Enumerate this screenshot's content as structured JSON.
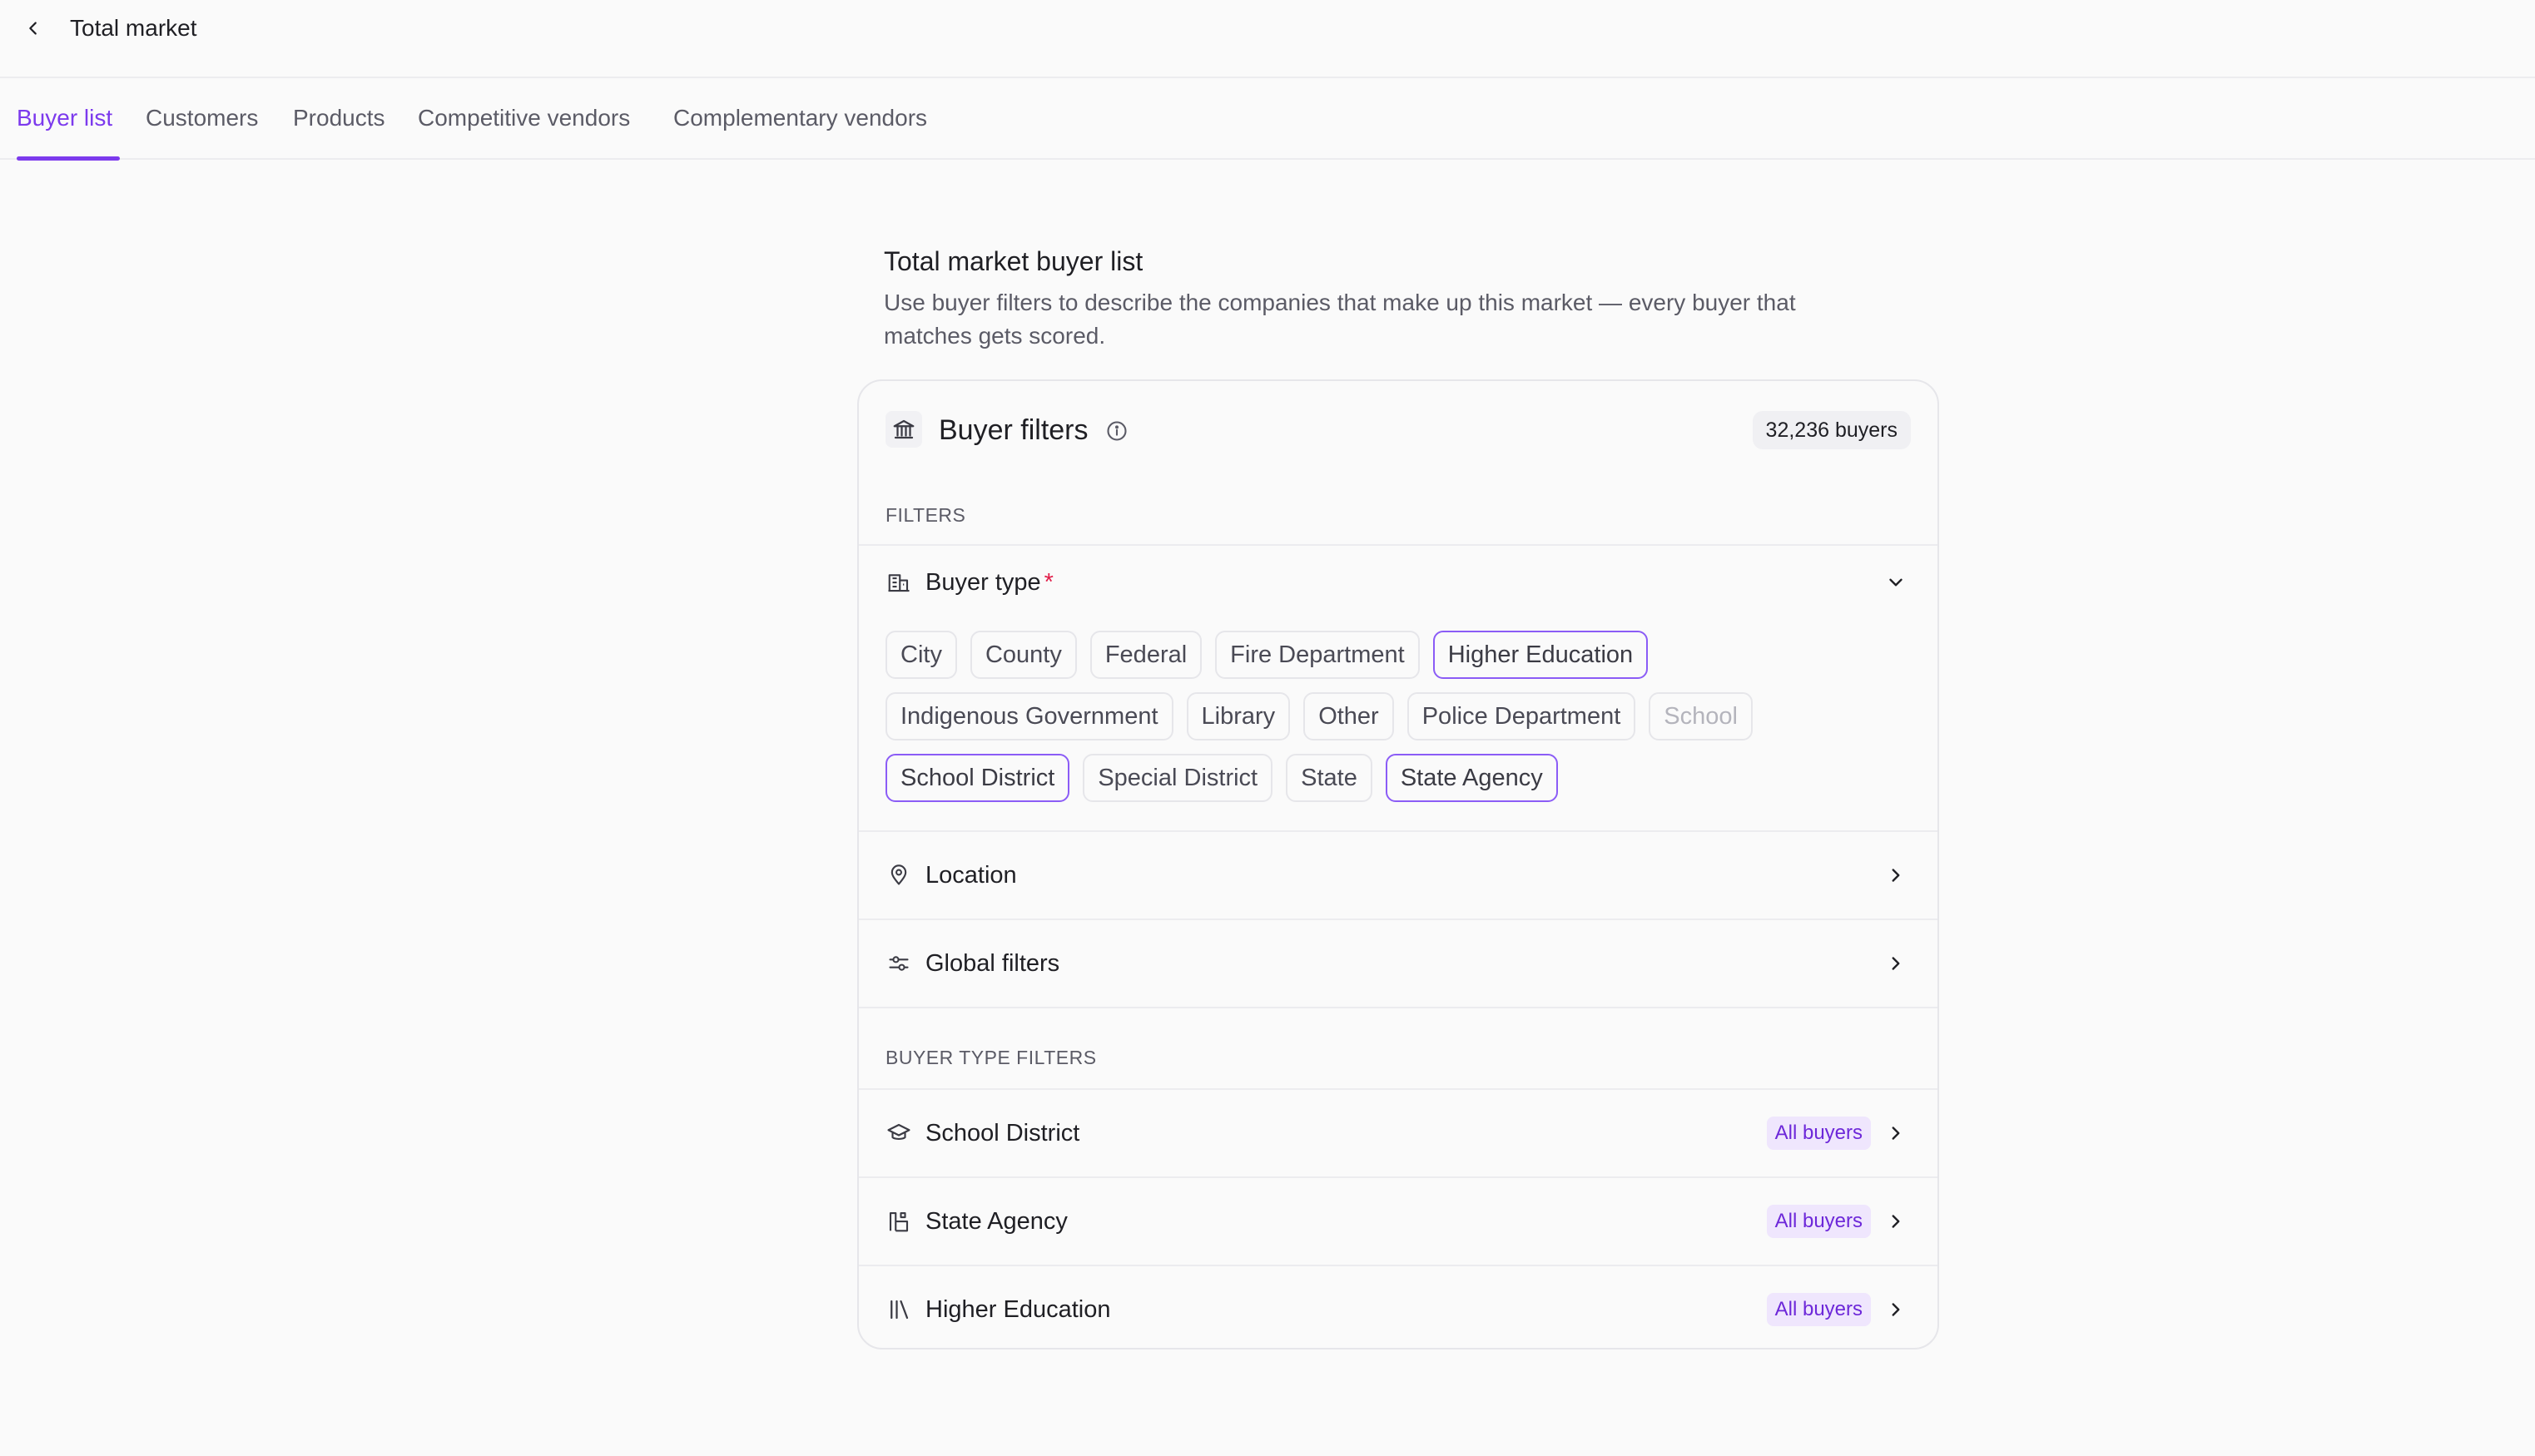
{
  "header": {
    "title": "Total market",
    "back_icon": "chevron-left-icon"
  },
  "tabs": [
    {
      "label": "Buyer list",
      "active": true
    },
    {
      "label": "Customers",
      "active": false
    },
    {
      "label": "Products",
      "active": false
    },
    {
      "label": "Competitive vendors",
      "active": false
    },
    {
      "label": "Complementary vendors",
      "active": false
    }
  ],
  "intro": {
    "title": "Total market buyer list",
    "description": "Use buyer filters to describe the companies that make up this market — every buyer that matches gets scored."
  },
  "card": {
    "title": "Buyer filters",
    "count": "32,236 buyers",
    "filters_label": "FILTERS",
    "buyer_type": {
      "label": "Buyer type",
      "required_mark": "*",
      "expanded": true,
      "chips": [
        [
          {
            "label": "City",
            "state": "default"
          },
          {
            "label": "County",
            "state": "default"
          },
          {
            "label": "Federal",
            "state": "default"
          },
          {
            "label": "Fire Department",
            "state": "default"
          },
          {
            "label": "Higher Education",
            "state": "selected"
          }
        ],
        [
          {
            "label": "Indigenous Government",
            "state": "default"
          },
          {
            "label": "Library",
            "state": "default"
          },
          {
            "label": "Other",
            "state": "default"
          },
          {
            "label": "Police Department",
            "state": "default"
          },
          {
            "label": "School",
            "state": "disabled"
          }
        ],
        [
          {
            "label": "School District",
            "state": "selected"
          },
          {
            "label": "Special District",
            "state": "default"
          },
          {
            "label": "State",
            "state": "default"
          },
          {
            "label": "State Agency",
            "state": "selected"
          }
        ]
      ]
    },
    "location_label": "Location",
    "global_filters_label": "Global filters",
    "buyer_type_filters_label": "BUYER TYPE FILTERS",
    "buyer_type_filters": [
      {
        "label": "School District",
        "badge": "All buyers",
        "icon": "graduation-cap-icon"
      },
      {
        "label": "State Agency",
        "badge": "All buyers",
        "icon": "agency-icon"
      },
      {
        "label": "Higher Education",
        "badge": "All buyers",
        "icon": "library-icon"
      }
    ]
  },
  "colors": {
    "accent": "#7c3aed",
    "badge_bg": "#efe6fd",
    "required": "#e11d48"
  }
}
